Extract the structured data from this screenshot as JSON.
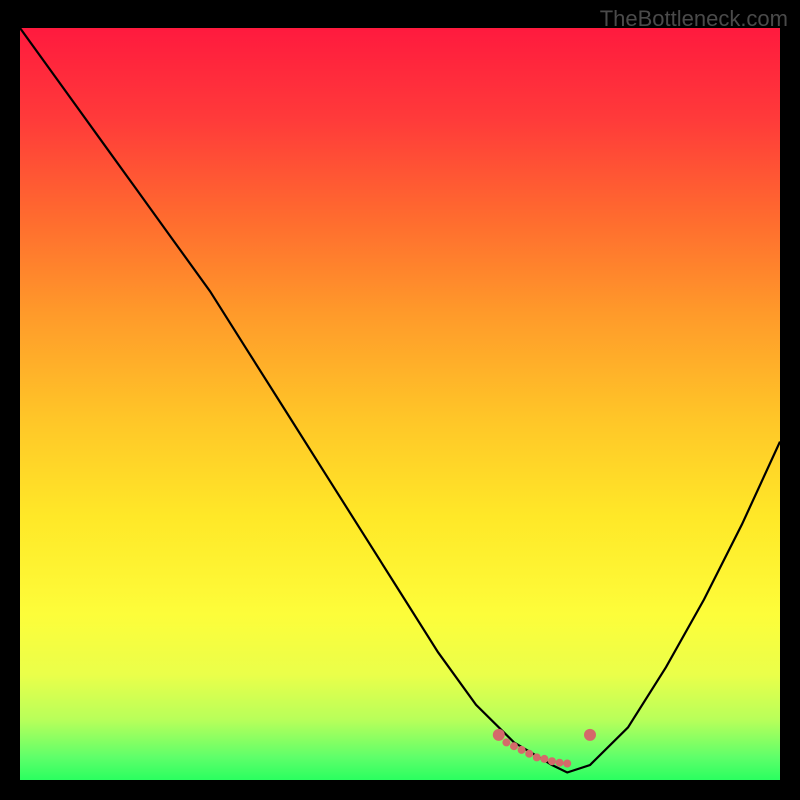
{
  "watermark": "TheBottleneck.com",
  "chart_data": {
    "type": "line",
    "title": "",
    "xlabel": "",
    "ylabel": "",
    "xlim": [
      0,
      100
    ],
    "ylim": [
      0,
      100
    ],
    "x": [
      0,
      5,
      10,
      15,
      20,
      25,
      30,
      35,
      40,
      45,
      50,
      55,
      60,
      65,
      70,
      72,
      75,
      80,
      85,
      90,
      95,
      100
    ],
    "values": [
      100,
      93,
      86,
      79,
      72,
      65,
      57,
      49,
      41,
      33,
      25,
      17,
      10,
      5,
      2,
      1,
      2,
      7,
      15,
      24,
      34,
      45
    ],
    "markers": {
      "x": [
        63,
        64,
        65,
        66,
        67,
        68,
        69,
        70,
        71,
        72,
        75
      ],
      "y": [
        6,
        5,
        4.5,
        4,
        3.5,
        3,
        2.8,
        2.5,
        2.3,
        2.2,
        6
      ],
      "color": "#d46a6a"
    }
  }
}
